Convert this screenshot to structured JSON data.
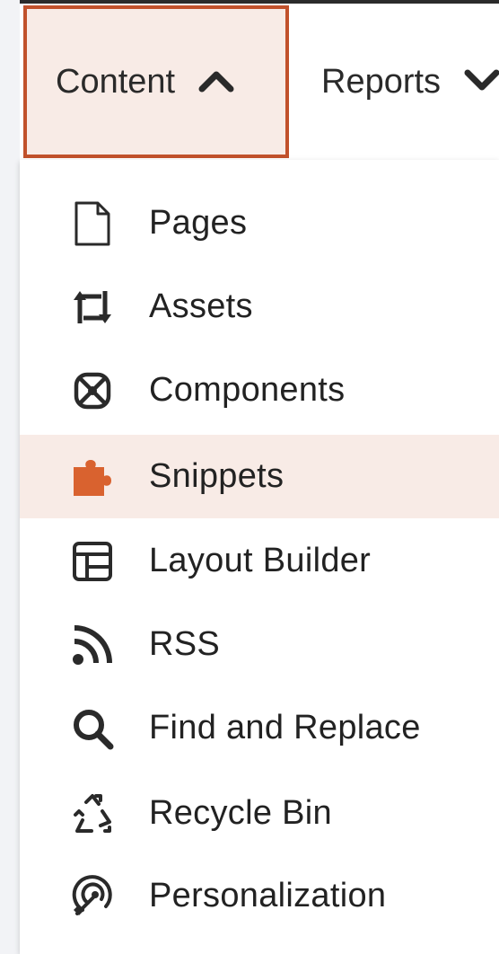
{
  "nav": {
    "tabs": [
      {
        "label": "Content",
        "state": "expanded",
        "icon": "chevron-up-icon"
      },
      {
        "label": "Reports",
        "state": "collapsed",
        "icon": "chevron-down-icon"
      }
    ]
  },
  "menu": {
    "items": [
      {
        "label": "Pages",
        "icon": "page-icon"
      },
      {
        "label": "Assets",
        "icon": "assets-icon"
      },
      {
        "label": "Components",
        "icon": "components-icon"
      },
      {
        "label": "Snippets",
        "icon": "puzzle-icon",
        "highlighted": true
      },
      {
        "label": "Layout Builder",
        "icon": "layout-icon"
      },
      {
        "label": "RSS",
        "icon": "rss-icon"
      },
      {
        "label": "Find and Replace",
        "icon": "search-icon"
      },
      {
        "label": "Recycle Bin",
        "icon": "recycle-icon"
      },
      {
        "label": "Personalization",
        "icon": "personalization-icon"
      }
    ]
  },
  "colors": {
    "accent": "#c1512b",
    "highlight_bg": "#f8ebe6",
    "text": "#222222"
  }
}
